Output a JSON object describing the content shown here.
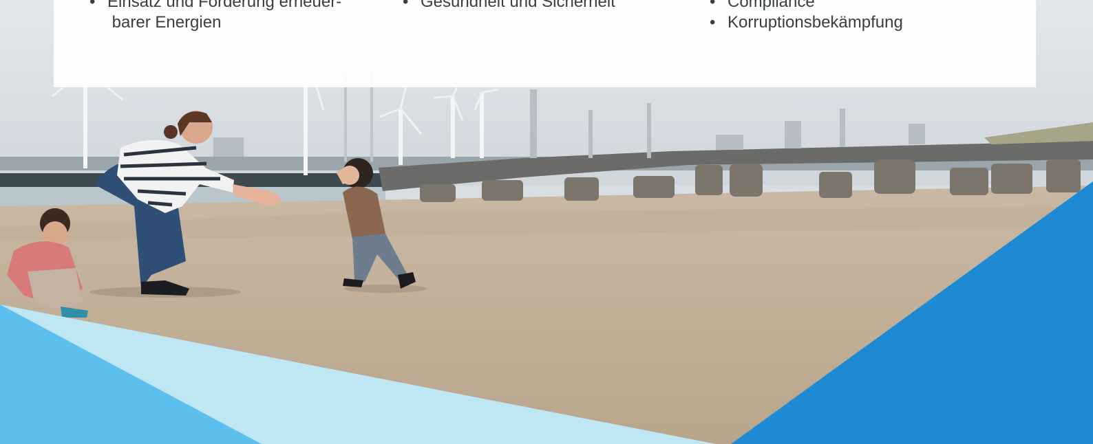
{
  "panel": {
    "column_left": [
      {
        "text": "Einsatz und Förderung erneuer- barer Energien"
      }
    ],
    "column_middle": [
      {
        "text": "Gesundheit und Sicherheit"
      }
    ],
    "column_right": [
      {
        "text": "Compliance"
      },
      {
        "text": "Korruptionsbekämpfung"
      }
    ]
  },
  "colors": {
    "panel_text": "#3a3d42",
    "accent_blue": "#1f8ad4",
    "accent_light_blue": "#5cbfed",
    "accent_pale_blue": "#bfe6f3"
  }
}
